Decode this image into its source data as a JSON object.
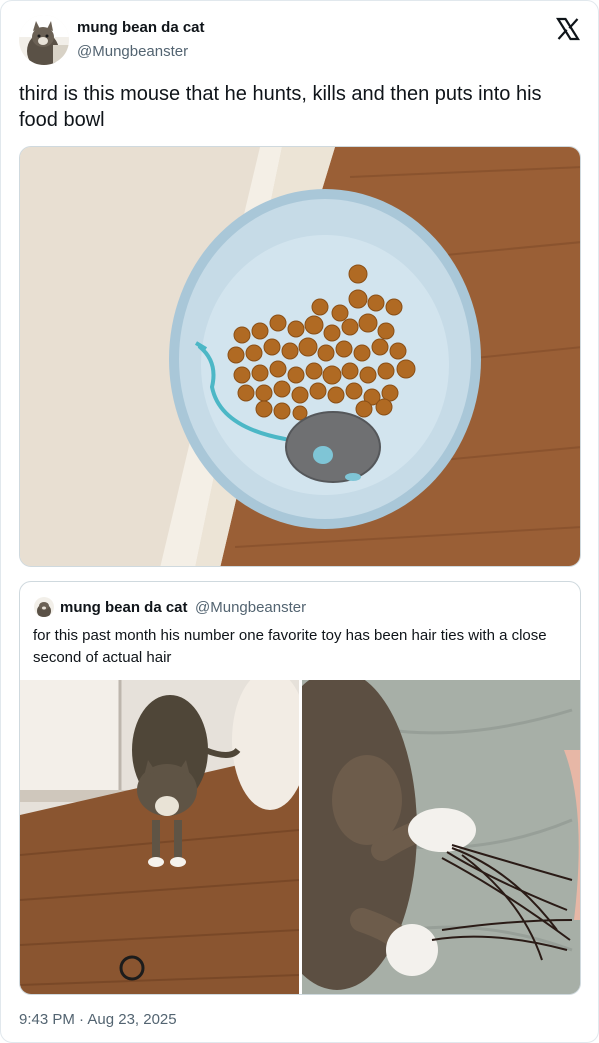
{
  "tweet": {
    "display_name": "mung bean da cat",
    "handle": "@Mungbeanster",
    "text": "third is this mouse that he hunts, kills and then puts into his food bowl",
    "timestamp": "9:43 PM · Aug 23, 2025"
  },
  "quoted_tweet": {
    "display_name": "mung bean da cat",
    "handle": "@Mungbeanster",
    "text": "for this past month his number one favorite toy has been hair ties with a close second of actual hair"
  },
  "icons": {
    "platform_logo": "x-logo-icon"
  },
  "colors": {
    "text_primary": "#0f1419",
    "text_secondary": "#536471",
    "border": "#cfd9de"
  }
}
